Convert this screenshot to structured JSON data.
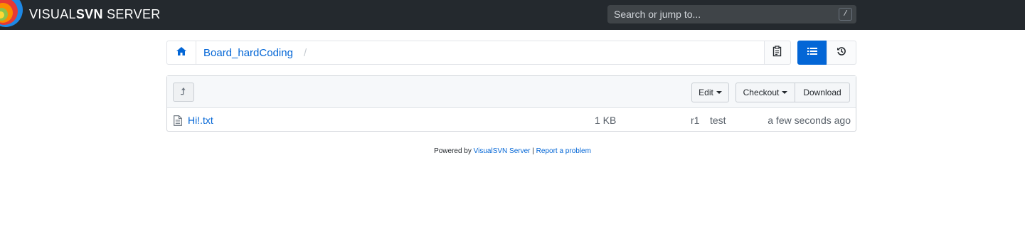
{
  "header": {
    "logo_visual": "VISUAL",
    "logo_svn": "SVN",
    "logo_server": " SERVER",
    "search_placeholder": "Search or jump to...",
    "search_shortcut": "/"
  },
  "breadcrumb": {
    "home_icon": "home-icon",
    "repo": "Board_hardCoding",
    "separator": "/"
  },
  "toolbar": {
    "copy_icon": "clipboard-icon",
    "list_icon": "list-icon",
    "history_icon": "history-icon",
    "accent": "#0366d6"
  },
  "browser": {
    "up_icon": "up-arrow-icon",
    "edit_label": "Edit",
    "checkout_label": "Checkout",
    "download_label": "Download",
    "files": [
      {
        "name": "Hi!.txt",
        "size": "1 KB",
        "revision": "r1",
        "author": "test",
        "date": "a few seconds ago"
      }
    ]
  },
  "footer": {
    "powered_by": "Powered by ",
    "product_link": "VisualSVN Server",
    "separator": " | ",
    "report_link": "Report a problem"
  }
}
